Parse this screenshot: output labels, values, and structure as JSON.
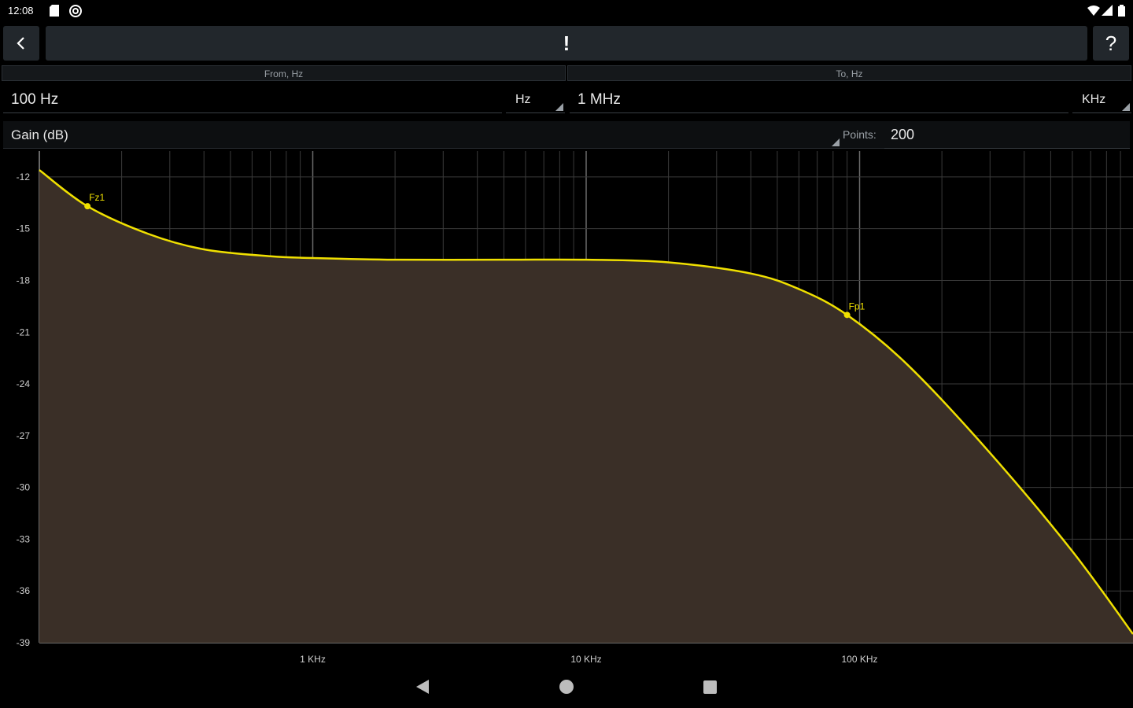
{
  "status": {
    "time": "12:08",
    "icons": [
      "sd-card-icon",
      "at-sign-icon",
      "wifi-icon",
      "signal-icon",
      "battery-icon"
    ]
  },
  "header": {
    "back_icon": "chevron-left-icon",
    "title": "!",
    "help_label": "?"
  },
  "range": {
    "from_header": "From, Hz",
    "to_header": "To, Hz",
    "from_value": "100 Hz",
    "from_unit": "Hz",
    "to_value": "1 MHz",
    "to_unit": "KHz"
  },
  "controls": {
    "mode": "Gain (dB)",
    "points_label": "Points:",
    "points_value": "200"
  },
  "colors": {
    "curve": "#f0e000",
    "fill": "#3a2f27",
    "grid": "#3a3a3a",
    "grid_major": "#6a6a6a"
  },
  "chart_data": {
    "type": "line",
    "xscale": "log",
    "xlim": [
      100,
      1000000
    ],
    "ylim": [
      -39,
      -10.5
    ],
    "y_ticks": [
      -12,
      -15,
      -18,
      -21,
      -24,
      -27,
      -30,
      -33,
      -36,
      -39
    ],
    "y_tick_labels": [
      "-12",
      "-15",
      "-18",
      "-21",
      "-24",
      "-27",
      "-30",
      "-33",
      "-36",
      "-39"
    ],
    "x_ticks": [
      1000,
      10000,
      100000
    ],
    "x_tick_labels": [
      "1 KHz",
      "10 KHz",
      "100 KHz"
    ],
    "series": [
      {
        "x": [
          100,
          150,
          250,
          400,
          700,
          1000,
          2000,
          5000,
          10000,
          20000,
          40000,
          60000,
          90000,
          150000,
          300000,
          600000,
          1000000
        ],
        "y": [
          -11.6,
          -13.7,
          -15.3,
          -16.2,
          -16.6,
          -16.7,
          -16.8,
          -16.8,
          -16.8,
          -16.95,
          -17.6,
          -18.5,
          -20.0,
          -22.9,
          -28.0,
          -33.7,
          -38.5
        ]
      }
    ],
    "markers": [
      {
        "label": "Fz1",
        "x": 150,
        "y": -13.7
      },
      {
        "label": "Fp1",
        "x": 90000,
        "y": -20.0
      }
    ],
    "grid": true
  },
  "navbar": {
    "icons": [
      "back-triangle-icon",
      "home-circle-icon",
      "recents-square-icon"
    ]
  }
}
